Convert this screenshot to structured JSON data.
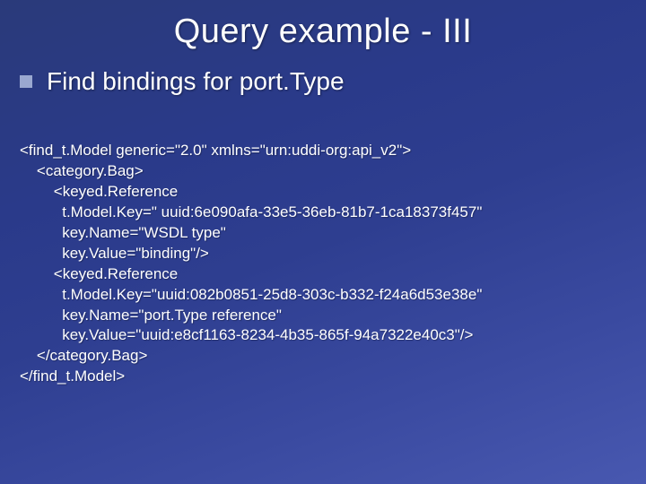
{
  "title": "Query example - III",
  "bullet": "Find bindings for port.Type",
  "code": "<find_t.Model generic=\"2.0\" xmlns=\"urn:uddi-org:api_v2\">\n    <category.Bag>\n        <keyed.Reference\n          t.Model.Key=\" uuid:6e090afa-33e5-36eb-81b7-1ca18373f457\"\n          key.Name=\"WSDL type\"\n          key.Value=\"binding\"/>\n        <keyed.Reference\n          t.Model.Key=\"uuid:082b0851-25d8-303c-b332-f24a6d53e38e\"\n          key.Name=\"port.Type reference\"\n          key.Value=\"uuid:e8cf1163-8234-4b35-865f-94a7322e40c3\"/>\n    </category.Bag>\n</find_t.Model>"
}
